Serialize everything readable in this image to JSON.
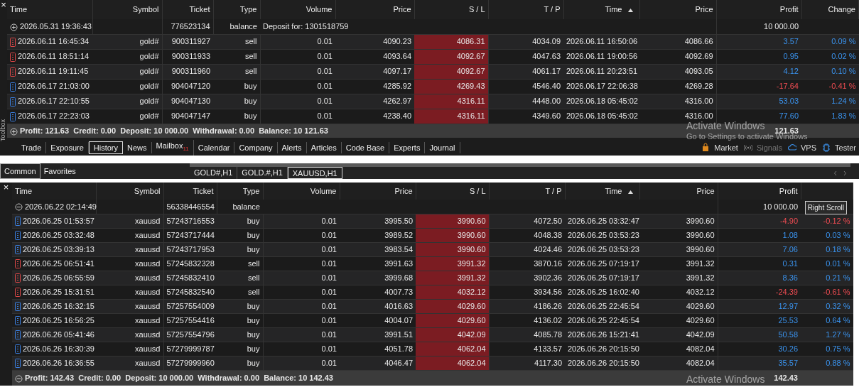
{
  "toolbox": {
    "close": "×",
    "label": "Toolbox"
  },
  "top": {
    "columns": [
      {
        "label": "Time",
        "sorted": false
      },
      {
        "label": "Symbol",
        "sorted": false
      },
      {
        "label": "Ticket",
        "sorted": false
      },
      {
        "label": "Type",
        "sorted": false
      },
      {
        "label": "Volume",
        "sorted": false
      },
      {
        "label": "Price",
        "sorted": false
      },
      {
        "label": "S / L",
        "sorted": false
      },
      {
        "label": "T / P",
        "sorted": false
      },
      {
        "label": "Time",
        "sorted": true
      },
      {
        "label": "Price",
        "sorted": false
      },
      {
        "label": "Profit",
        "sorted": false
      },
      {
        "label": "Change",
        "sorted": false
      }
    ],
    "rows": [
      {
        "kind": "balance",
        "expanded": false,
        "time": "2026.05.31 19:36:43",
        "ticket": "776523134",
        "type": "balance",
        "comment": "Deposit for: 1301518759",
        "profit": "10 000.00"
      },
      {
        "kind": "sell",
        "loss": false,
        "cells": [
          "2026.06.11 16:45:34",
          "gold#",
          "900311927",
          "sell",
          "0.01",
          "4090.23",
          "4086.31",
          "4034.09",
          "2026.06.11 16:50:06",
          "4086.66",
          "3.57",
          "0.09 %"
        ]
      },
      {
        "kind": "sell",
        "loss": false,
        "cells": [
          "2026.06.11 18:51:14",
          "gold#",
          "900311933",
          "sell",
          "0.01",
          "4093.64",
          "4092.67",
          "4047.63",
          "2026.06.11 19:00:56",
          "4092.69",
          "0.95",
          "0.02 %"
        ]
      },
      {
        "kind": "sell",
        "loss": false,
        "cells": [
          "2026.06.11 19:11:45",
          "gold#",
          "900311960",
          "sell",
          "0.01",
          "4097.17",
          "4092.67",
          "4061.17",
          "2026.06.11 20:23:51",
          "4093.05",
          "4.12",
          "0.10 %"
        ]
      },
      {
        "kind": "buy",
        "loss": true,
        "cells": [
          "2026.06.17 21:03:00",
          "gold#",
          "904047120",
          "buy",
          "0.01",
          "4285.92",
          "4269.43",
          "4546.40",
          "2026.06.17 22:06:38",
          "4269.28",
          "-17.64",
          "-0.41 %"
        ]
      },
      {
        "kind": "buy",
        "loss": false,
        "cells": [
          "2026.06.17 22:10:55",
          "gold#",
          "904047130",
          "buy",
          "0.01",
          "4262.97",
          "4316.11",
          "4448.00",
          "2026.06.18 05:45:02",
          "4316.00",
          "53.03",
          "1.24 %"
        ]
      },
      {
        "kind": "buy",
        "loss": false,
        "cells": [
          "2026.06.17 22:23:03",
          "gold#",
          "904047147",
          "buy",
          "0.01",
          "4238.40",
          "4316.11",
          "4349.60",
          "2026.06.18 05:45:02",
          "4316.00",
          "77.60",
          "1.83 %"
        ]
      }
    ],
    "summary": {
      "expanded": false,
      "text": "Profit: 121.63  Credit: 0.00  Deposit: 10 000.00  Withdrawal: 0.00  Balance: 10 121.63",
      "profit": "121.63"
    },
    "notice": [
      "Activate Windows",
      "Go to Settings to activate Windows"
    ]
  },
  "tabs": [
    {
      "label": "Trade",
      "selected": false
    },
    {
      "label": "Exposure",
      "selected": false
    },
    {
      "label": "History",
      "selected": true
    },
    {
      "label": "News",
      "selected": false
    },
    {
      "label": "Mailbox",
      "selected": false,
      "badge": "11"
    },
    {
      "label": "Calendar",
      "selected": false
    },
    {
      "label": "Company",
      "selected": false
    },
    {
      "label": "Alerts",
      "selected": false
    },
    {
      "label": "Articles",
      "selected": false
    },
    {
      "label": "Code Base",
      "selected": false
    },
    {
      "label": "Experts",
      "selected": false
    },
    {
      "label": "Journal",
      "selected": false
    }
  ],
  "services": [
    {
      "kind": "market",
      "label": "Market",
      "disabled": false
    },
    {
      "kind": "signals",
      "label": "Signals",
      "disabled": true
    },
    {
      "kind": "vps",
      "label": "VPS",
      "disabled": false
    },
    {
      "kind": "tester",
      "label": "Tester",
      "disabled": false
    }
  ],
  "bottom": {
    "close": "×",
    "filter_tabs": [
      {
        "label": "Common",
        "selected": true
      },
      {
        "label": "Favorites",
        "selected": false
      }
    ],
    "chart_tabs": [
      {
        "label": "GOLD#,H1",
        "selected": false
      },
      {
        "label": "GOLD.#,H1",
        "selected": false
      },
      {
        "label": "XAUUSD,H1",
        "selected": true
      }
    ],
    "tooltip": "Right Scroll",
    "columns": [
      {
        "label": "Time",
        "sorted": false
      },
      {
        "label": "Symbol",
        "sorted": false
      },
      {
        "label": "Ticket",
        "sorted": false
      },
      {
        "label": "Type",
        "sorted": false
      },
      {
        "label": "Volume",
        "sorted": false
      },
      {
        "label": "Price",
        "sorted": false
      },
      {
        "label": "S / L",
        "sorted": false
      },
      {
        "label": "T / P",
        "sorted": false
      },
      {
        "label": "Time",
        "sorted": true
      },
      {
        "label": "Price",
        "sorted": false
      },
      {
        "label": "Profit",
        "sorted": false
      }
    ],
    "rows": [
      {
        "kind": "balance",
        "expanded": true,
        "time": "2026.06.22 02:14:49",
        "ticket": "56338446554",
        "type": "balance",
        "profit": "10 000.00"
      },
      {
        "kind": "buy",
        "loss": true,
        "cells": [
          "2026.06.25 01:53:57",
          "xauusd",
          "57243716553",
          "buy",
          "0.01",
          "3995.50",
          "3990.60",
          "4072.50",
          "2026.06.25 03:32:47",
          "3990.60",
          "-4.90",
          "-0.12 %"
        ]
      },
      {
        "kind": "buy",
        "loss": false,
        "cells": [
          "2026.06.25 03:32:48",
          "xauusd",
          "57243717444",
          "buy",
          "0.01",
          "3989.52",
          "3990.60",
          "4048.38",
          "2026.06.25 03:53:23",
          "3990.60",
          "1.08",
          "0.03 %"
        ]
      },
      {
        "kind": "buy",
        "loss": false,
        "cells": [
          "2026.06.25 03:39:13",
          "xauusd",
          "57243717953",
          "buy",
          "0.01",
          "3983.54",
          "3990.60",
          "4024.46",
          "2026.06.25 03:53:23",
          "3990.60",
          "7.06",
          "0.18 %"
        ]
      },
      {
        "kind": "sell",
        "loss": false,
        "cells": [
          "2026.06.25 06:51:41",
          "xauusd",
          "57245832328",
          "sell",
          "0.01",
          "3991.63",
          "3991.32",
          "3870.16",
          "2026.06.25 07:19:17",
          "3991.32",
          "0.31",
          "0.01 %"
        ]
      },
      {
        "kind": "sell",
        "loss": false,
        "cells": [
          "2026.06.25 06:55:59",
          "xauusd",
          "57245832410",
          "sell",
          "0.01",
          "3999.68",
          "3991.32",
          "3902.36",
          "2026.06.25 07:19:17",
          "3991.32",
          "8.36",
          "0.21 %"
        ]
      },
      {
        "kind": "sell",
        "loss": true,
        "cells": [
          "2026.06.25 15:31:51",
          "xauusd",
          "57245832540",
          "sell",
          "0.01",
          "4007.73",
          "4032.12",
          "3934.56",
          "2026.06.25 16:02:40",
          "4032.12",
          "-24.39",
          "-0.61 %"
        ]
      },
      {
        "kind": "buy",
        "loss": false,
        "cells": [
          "2026.06.25 16:32:15",
          "xauusd",
          "57257554009",
          "buy",
          "0.01",
          "4016.63",
          "4029.60",
          "4186.26",
          "2026.06.25 22:45:54",
          "4029.60",
          "12.97",
          "0.32 %"
        ]
      },
      {
        "kind": "buy",
        "loss": false,
        "cells": [
          "2026.06.25 16:56:25",
          "xauusd",
          "57257554416",
          "buy",
          "0.01",
          "4004.07",
          "4029.60",
          "4136.02",
          "2026.06.25 22:45:54",
          "4029.60",
          "25.53",
          "0.64 %"
        ]
      },
      {
        "kind": "buy",
        "loss": false,
        "cells": [
          "2026.06.26 05:41:46",
          "xauusd",
          "57257554796",
          "buy",
          "0.01",
          "3991.51",
          "4042.09",
          "4085.78",
          "2026.06.26 15:21:41",
          "4042.09",
          "50.58",
          "1.27 %"
        ]
      },
      {
        "kind": "buy",
        "loss": false,
        "cells": [
          "2026.06.26 16:30:39",
          "xauusd",
          "57279999787",
          "buy",
          "0.01",
          "4051.78",
          "4062.04",
          "4133.57",
          "2026.06.26 20:15:50",
          "4082.04",
          "30.26",
          "0.75 %"
        ]
      },
      {
        "kind": "buy",
        "loss": false,
        "cells": [
          "2026.06.26 16:36:55",
          "xauusd",
          "57279999960",
          "buy",
          "0.01",
          "4046.47",
          "4062.04",
          "4117.30",
          "2026.06.26 20:15:50",
          "4082.04",
          "35.57",
          "0.88 %"
        ]
      }
    ],
    "summary": {
      "expanded": true,
      "text": "Profit: 142.43  Credit: 0.00  Deposit: 10 000.00  Withdrawal: 0.00  Balance: 10 142.43",
      "profit": "142.43"
    },
    "notice": [
      "Activate Windows"
    ]
  }
}
